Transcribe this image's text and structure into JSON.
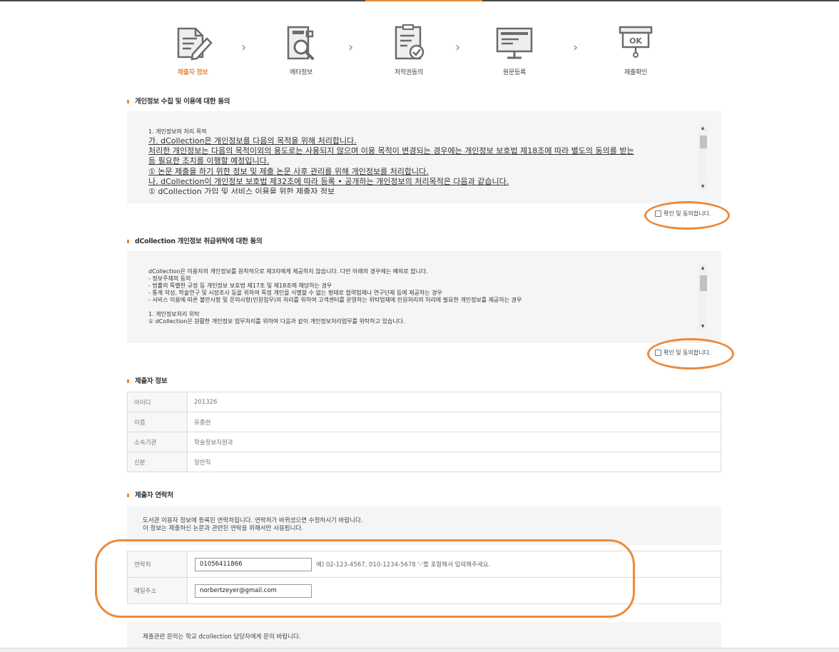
{
  "steps": [
    {
      "label": "제출자 정보",
      "icon": "document-pen-icon",
      "active": true
    },
    {
      "label": "메타정보",
      "icon": "document-search-icon",
      "active": false
    },
    {
      "label": "저작권동의",
      "icon": "clipboard-check-icon",
      "active": false
    },
    {
      "label": "원문등록",
      "icon": "monitor-icon",
      "active": false
    },
    {
      "label": "제출확인",
      "icon": "ok-sign-icon",
      "active": false
    }
  ],
  "ok_text": "OK",
  "chevron": "›",
  "section1": {
    "title": "개인정보 수집 및 이용에 대한 동의",
    "lines": [
      "1. 개인정보의 처리 목적",
      "가. dCollection은 개인정보를 다음의 목적을 위해 처리합니다.",
      "처리한 개인정보는 다음의 목적이외의 용도로는 사용되지 않으며 이용 목적이 변경되는 경우에는 개인정보 보호법 제18조에 따라 별도의 동의를 받는",
      "등 필요한 조치를 이행할 예정입니다.",
      "① 논문 제출을 하기 위한 정보 및 제출 논문 사후 관리를 위해 개인정보를 처리합니다.",
      "나. dCollection이 개인정보 보호법 제32조에 따라 등록 • 공개하는 개인정보의 처리목적은 다음과 같습니다.",
      "① dCollection 가입 및 서비스 이용을 위한 제출자 정보"
    ],
    "agree_label": "확인 및 동의합니다."
  },
  "section2": {
    "title": "dCollection 개인정보 취급위탁에 대한 동의",
    "lines": [
      "dCollection은 이용자의 개인정보를 원칙적으로 제3자에게 제공하지 않습니다. 다만 아래의 경우에는 예외로 합니다.",
      "- 정보주체의 동의",
      "- 법률의 특별한 규정 등 개인정보 보호법 제17조 및 제18조에 해당하는 경우",
      "- 통계 작성, 학술연구 및 시장조사 등을 위하여 특정 개인을 식별할 수 없는 형태로 협력업체나 연구단체 등에 제공하는 경우",
      "- 서비스 이용에 따른 불만사항 및 문의사항(민원업무)의 처리를 위하여 고객센터를 운영하는 위탁업체에 민원처리의 처리에 필요한 개인정보를 제공하는 경우",
      "",
      "1. 개인정보처리 위탁",
      "① dCollection은 원활한 개인정보 업무처리를 위하여 다음과 같이 개인정보처리업무를 위탁하고 있습니다."
    ],
    "agree_label": "확인 및 동의합니다."
  },
  "submitter": {
    "title": "제출자 정보",
    "rows": [
      {
        "key": "아이디",
        "value": "201326"
      },
      {
        "key": "이름",
        "value": "유종현"
      },
      {
        "key": "소속기관",
        "value": "학술정보지원과"
      },
      {
        "key": "신분",
        "value": "일반직"
      }
    ]
  },
  "contact": {
    "title": "제출자 연락처",
    "notice_line1": "도서관 이용자 정보에 등록된 연락처입니다. 연락처가 바뀌셨으면 수정하시기 바랍니다.",
    "notice_line2": "이 정보는 제출하신 논문과 관련된 연락을 위해서만 사용됩니다.",
    "phone_label": "연락처",
    "phone_value": "01056411866",
    "phone_hint": "예) 02-123-4567, 010-1234-5678 '-'를 포함해서 입력해주세요.",
    "email_label": "메일주소",
    "email_value": "norbertzeyer@gmail.com"
  },
  "footer_notice": "제출관련 문의는 학교 dcollection 담당자에게 문의 바랍니다.",
  "colors": {
    "accent": "#e8893a",
    "annotation": "#ec8a3b"
  }
}
